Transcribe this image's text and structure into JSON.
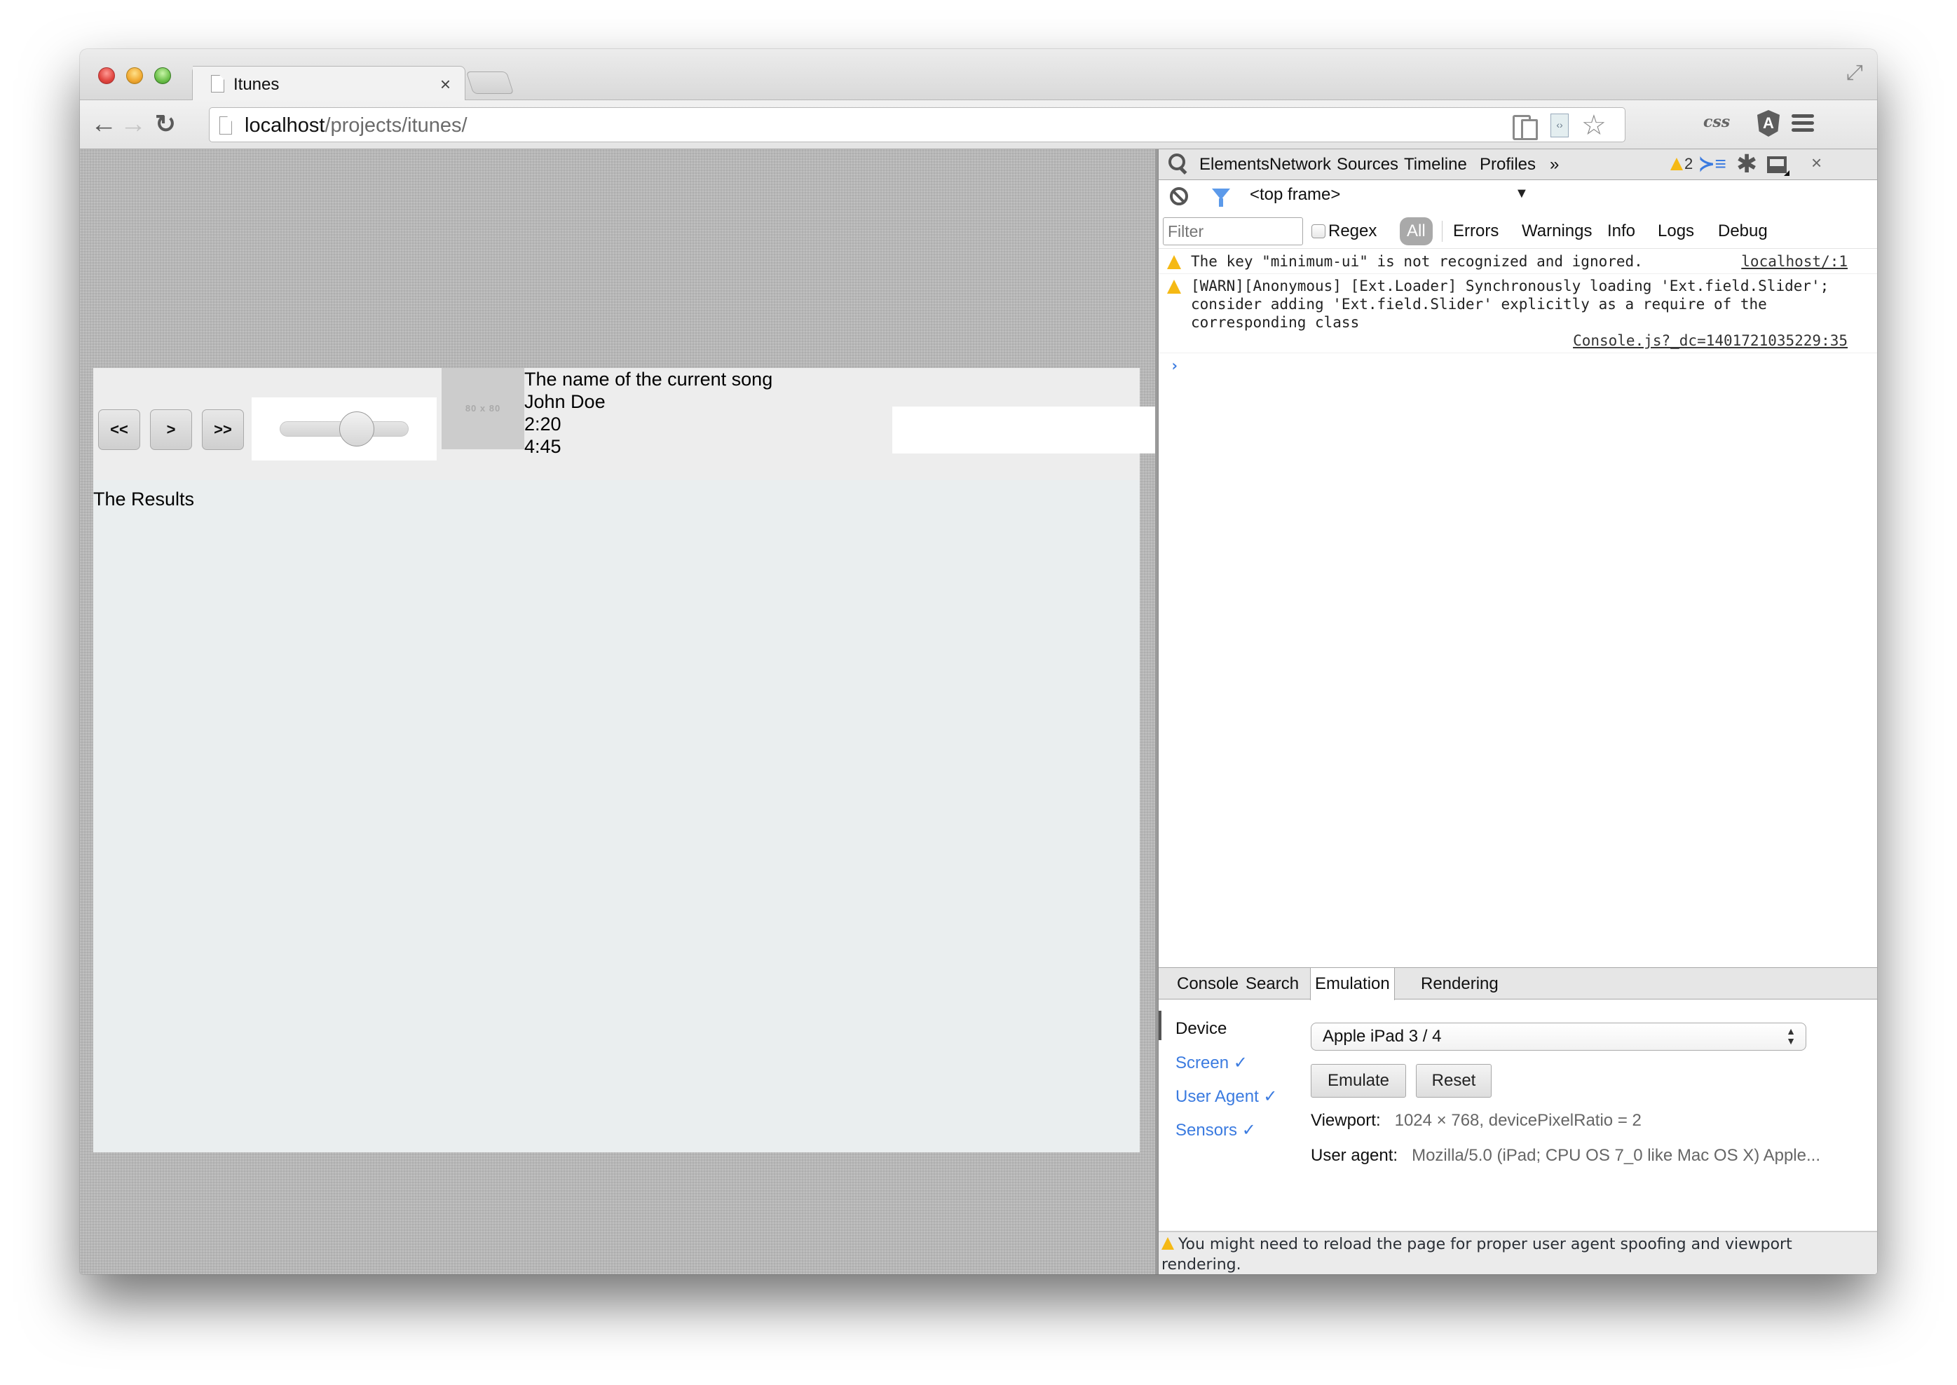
{
  "browser": {
    "tab": {
      "title": "Itunes",
      "close_glyph": "×"
    },
    "toolbar": {
      "back_glyph": "←",
      "forward_glyph": "→",
      "reload_glyph": "↻",
      "url_host": "localhost",
      "url_path": "/projects/itunes/",
      "star_glyph": "☆",
      "fullscreen_glyph": "⤢",
      "extensions": {
        "css_label": "css",
        "angular_label": "A"
      }
    }
  },
  "page": {
    "player": {
      "buttons": [
        {
          "name": "previous",
          "label": "<<"
        },
        {
          "name": "play",
          "label": ">"
        },
        {
          "name": "next",
          "label": ">>"
        }
      ],
      "slider_value_fraction": 0.6,
      "album_art_placeholder": "80 x 80",
      "song_title": "The name of the current song",
      "artist": "John Doe",
      "elapsed": "2:20",
      "duration": "4:45",
      "search_value": ""
    },
    "results_label": "The Results"
  },
  "devtools": {
    "tabs": [
      "Elements",
      "Network",
      "Sources",
      "Timeline",
      "Profiles"
    ],
    "more_glyph": "»",
    "warning_count": "2",
    "drawer_glyph": "≻≡",
    "gear_glyph": "✱",
    "close_glyph": "×",
    "console": {
      "frame": "<top frame>",
      "frame_arrow": "▼",
      "filter_placeholder": "Filter",
      "regex_label": "Regex",
      "levels": [
        "All",
        "Errors",
        "Warnings",
        "Info",
        "Logs",
        "Debug"
      ],
      "active_level": "All",
      "messages": [
        {
          "level": "warning",
          "text": "The key \"minimum-ui\" is not recognized and ignored.",
          "source": "localhost/:1"
        },
        {
          "level": "warning",
          "text": "[WARN][Anonymous] [Ext.Loader] Synchronously loading 'Ext.field.Slider'; consider adding 'Ext.field.Slider' explicitly as a require of the corresponding class",
          "source": "Console.js?_dc=1401721035229:35"
        }
      ],
      "prompt_glyph": "›"
    },
    "drawer": {
      "tabs": [
        "Console",
        "Search",
        "Emulation",
        "Rendering"
      ],
      "active_tab": "Emulation",
      "emulation": {
        "sections": [
          {
            "label": "Device",
            "active": true
          },
          {
            "label": "Screen ✓",
            "active": false
          },
          {
            "label": "User Agent ✓",
            "active": false
          },
          {
            "label": "Sensors ✓",
            "active": false
          }
        ],
        "device_selected": "Apple iPad 3 / 4",
        "select_arrows": "▲▼",
        "emulate_label": "Emulate",
        "reset_label": "Reset",
        "viewport_label": "Viewport:",
        "viewport_value": "1024 × 768, devicePixelRatio = 2",
        "user_agent_label": "User agent:",
        "user_agent_value": "Mozilla/5.0 (iPad; CPU OS 7_0 like Mac OS X) Apple...",
        "footer_warning": "You might need to reload the page for proper user agent spoofing and viewport rendering."
      }
    }
  }
}
